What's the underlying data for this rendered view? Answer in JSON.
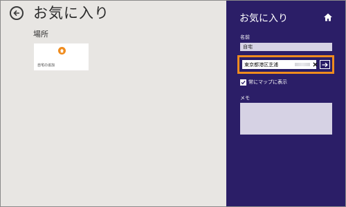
{
  "main": {
    "title": "お気に入り",
    "section_label": "場所",
    "tiles": [
      {
        "label": "自宅の追加",
        "icon": "home-icon"
      }
    ]
  },
  "pane": {
    "title": "お気に入り",
    "name_label": "名前",
    "name_value": "自宅",
    "address_value": "東京都港区芝浦",
    "always_show_label": "常にマップに表示",
    "always_show_checked": true,
    "memo_label": "メモ",
    "memo_value": ""
  },
  "colors": {
    "pane_bg": "#2b1e67",
    "main_bg": "#e8e6e3",
    "accent": "#f08c1e",
    "field_bg": "#d6d2e4"
  }
}
